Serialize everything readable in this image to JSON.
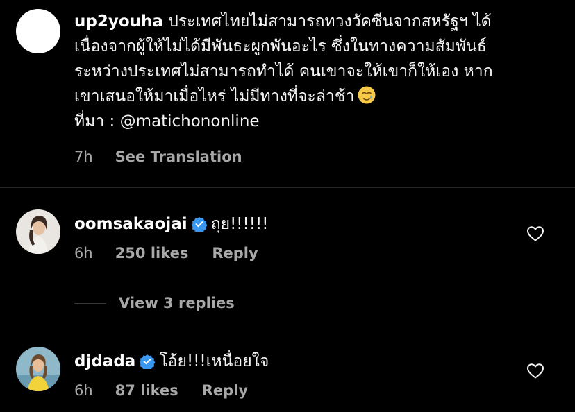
{
  "caption": {
    "username": "up2youha",
    "text_lines": [
      "ประเทศไทยไม่สามารถทวงวัคซีนจากสหรัฐฯ ได้",
      "เนื่องจากผู้ให้ไม่ได้มีพันธะผูกพันอะไร ซึ่งในทางความสัมพันธ์",
      "ระหว่างประเทศไม่สามารถทำได้ คนเขาจะให้เขาก็ให้เอง หาก",
      "เขาเสนอให้มาเมื่อไหร่ ไม่มีทางที่จะล่าช้า"
    ],
    "emoji": "crying-face-emoji",
    "source_prefix": "ที่มา : ",
    "source_handle": "@matichononline",
    "time": "7h",
    "see_translation": "See Translation"
  },
  "comments": [
    {
      "username": "oomsakaojai",
      "verified": true,
      "text": "ถุย!!!!!!",
      "time": "6h",
      "likes": "250 likes",
      "reply": "Reply"
    },
    {
      "username": "djdada",
      "verified": true,
      "text": "โอ้ย!!!เหนื่อยใจ",
      "time": "6h",
      "likes": "87 likes",
      "reply": "Reply"
    }
  ],
  "view_replies": "View 3 replies",
  "colors": {
    "background": "#000000",
    "secondary_text": "#a8a8a8",
    "verified_blue": "#3897f0",
    "divider": "#262626"
  },
  "icons": [
    "heart-outline-icon",
    "verified-badge-icon"
  ]
}
